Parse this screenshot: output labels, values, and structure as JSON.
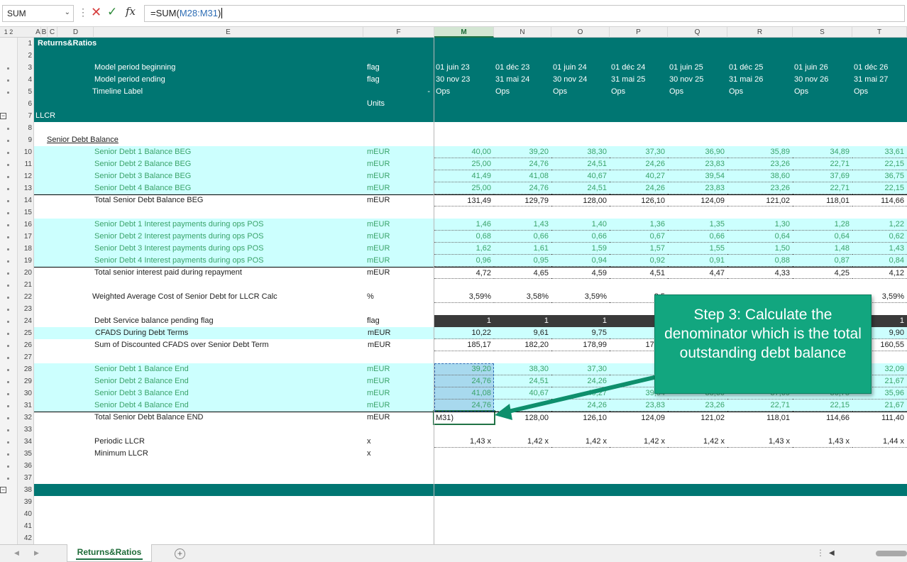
{
  "formula_bar": {
    "name_box": "SUM",
    "formula_prefix": "=SUM(",
    "formula_ref": "M28:M31",
    "formula_suffix": ")",
    "cancel_icon": "close-icon",
    "enter_icon": "check-icon",
    "fx_label": "fx"
  },
  "outline_levels": "1 2",
  "columns_left": [
    "A",
    "B",
    "C",
    "D",
    "E",
    "F"
  ],
  "columns_right": [
    "M",
    "N",
    "O",
    "P",
    "Q",
    "R",
    "S",
    "T"
  ],
  "selected_column": "M",
  "row_numbers": [
    "1",
    "2",
    "3",
    "4",
    "5",
    "6",
    "7",
    "8",
    "9",
    "10",
    "11",
    "12",
    "13",
    "14",
    "15",
    "16",
    "17",
    "18",
    "19",
    "20",
    "21",
    "22",
    "23",
    "24",
    "25",
    "26",
    "27",
    "28",
    "29",
    "30",
    "31",
    "32",
    "33",
    "34",
    "35",
    "36",
    "37",
    "38",
    "39",
    "40",
    "41",
    "42"
  ],
  "header_rows": {
    "r1_title": "Returns&Ratios",
    "r3_label": "Model period beginning",
    "r3_unit": "flag",
    "r4_label": "Model period ending",
    "r4_unit": "flag",
    "r5_label": "Timeline Label",
    "r5_unit": "-",
    "r6_unit": "Units",
    "r7_label": "LLCR",
    "beginning": [
      "01 juin 23",
      "01 déc 23",
      "01 juin 24",
      "01 déc 24",
      "01 juin 25",
      "01 déc 25",
      "01 juin 26",
      "01 déc 26"
    ],
    "ending": [
      "30 nov 23",
      "31 mai 24",
      "30 nov 24",
      "31 mai 25",
      "30 nov 25",
      "31 mai 26",
      "30 nov 26",
      "31 mai 27"
    ],
    "timeline": [
      "Ops",
      "Ops",
      "Ops",
      "Ops",
      "Ops",
      "Ops",
      "Ops",
      "Ops"
    ]
  },
  "section_title": "Senior Debt Balance",
  "rows": {
    "r10": {
      "label": "Senior Debt 1 Balance BEG",
      "unit": "mEUR",
      "values": [
        "40,00",
        "39,20",
        "38,30",
        "37,30",
        "36,90",
        "35,89",
        "34,89",
        "33,61"
      ]
    },
    "r11": {
      "label": "Senior Debt 2 Balance BEG",
      "unit": "mEUR",
      "values": [
        "25,00",
        "24,76",
        "24,51",
        "24,26",
        "23,83",
        "23,26",
        "22,71",
        "22,15"
      ]
    },
    "r12": {
      "label": "Senior Debt 3 Balance BEG",
      "unit": "mEUR",
      "values": [
        "41,49",
        "41,08",
        "40,67",
        "40,27",
        "39,54",
        "38,60",
        "37,69",
        "36,75"
      ]
    },
    "r13": {
      "label": "Senior Debt 4 Balance BEG",
      "unit": "mEUR",
      "values": [
        "25,00",
        "24,76",
        "24,51",
        "24,26",
        "23,83",
        "23,26",
        "22,71",
        "22,15"
      ]
    },
    "r14": {
      "label": "Total Senior Debt Balance BEG",
      "unit": "mEUR",
      "values": [
        "131,49",
        "129,79",
        "128,00",
        "126,10",
        "124,09",
        "121,02",
        "118,01",
        "114,66"
      ]
    },
    "r16": {
      "label": "Senior Debt 1 Interest payments during ops POS",
      "unit": "mEUR",
      "values": [
        "1,46",
        "1,43",
        "1,40",
        "1,36",
        "1,35",
        "1,30",
        "1,28",
        "1,22"
      ]
    },
    "r17": {
      "label": "Senior Debt 2 Interest payments during ops POS",
      "unit": "mEUR",
      "values": [
        "0,68",
        "0,66",
        "0,66",
        "0,67",
        "0,66",
        "0,64",
        "0,64",
        "0,62"
      ]
    },
    "r18": {
      "label": "Senior Debt 3 Interest payments during ops POS",
      "unit": "mEUR",
      "values": [
        "1,62",
        "1,61",
        "1,59",
        "1,57",
        "1,55",
        "1,50",
        "1,48",
        "1,43"
      ]
    },
    "r19": {
      "label": "Senior Debt 4 Interest payments during ops POS",
      "unit": "mEUR",
      "values": [
        "0,96",
        "0,95",
        "0,94",
        "0,92",
        "0,91",
        "0,88",
        "0,87",
        "0,84"
      ]
    },
    "r20": {
      "label": "Total senior interest paid during repayment",
      "unit": "mEUR",
      "values": [
        "4,72",
        "4,65",
        "4,59",
        "4,51",
        "4,47",
        "4,33",
        "4,25",
        "4,12"
      ]
    },
    "r22": {
      "label": "Weighted Average Cost of Senior Debt for LLCR Calc",
      "unit": "%",
      "values": [
        "3,59%",
        "3,58%",
        "3,59%",
        "3,5",
        "",
        "",
        "",
        "3,59%"
      ]
    },
    "r24": {
      "label": "Debt Service balance pending flag",
      "unit": "flag",
      "values": [
        "1",
        "1",
        "1",
        "",
        "",
        "",
        "",
        "1"
      ]
    },
    "r25": {
      "label": "CFADS During Debt Terms",
      "unit": "mEUR",
      "values": [
        "10,22",
        "9,61",
        "9,75",
        "9,6",
        "",
        "",
        "",
        "9,90"
      ]
    },
    "r26": {
      "label": "Sum of Discounted CFADS over Senior Debt Term",
      "unit": "mEUR",
      "values": [
        "185,17",
        "182,20",
        "178,99",
        "175,1",
        "",
        "",
        "",
        "160,55"
      ]
    },
    "r28": {
      "label": "Senior Debt 1 Balance End",
      "unit": "mEUR",
      "values": [
        "39,20",
        "38,30",
        "37,30",
        "36,",
        "",
        "",
        "",
        "32,09"
      ]
    },
    "r29": {
      "label": "Senior Debt 2 Balance End",
      "unit": "mEUR",
      "values": [
        "24,76",
        "24,51",
        "24,26",
        "23,",
        "",
        "",
        "",
        "21,67"
      ]
    },
    "r30": {
      "label": "Senior Debt 3 Balance End",
      "unit": "mEUR",
      "values": [
        "41,08",
        "40,67",
        "40,27",
        "39,54",
        "38,60",
        "37,69",
        "36,75",
        "35,96"
      ]
    },
    "r31": {
      "label": "Senior Debt 4 Balance End",
      "unit": "mEUR",
      "values": [
        "24,76",
        "",
        "24,26",
        "23,83",
        "23,26",
        "22,71",
        "22,15",
        "21,67"
      ]
    },
    "r32": {
      "label": "Total Senior Debt Balance END",
      "unit": "mEUR",
      "values": [
        "M31)",
        "128,00",
        "126,10",
        "124,09",
        "121,02",
        "118,01",
        "114,66",
        "111,40"
      ]
    },
    "r34": {
      "label": "Periodic   LLCR",
      "unit": "x",
      "values": [
        "1,43 x",
        "1,42 x",
        "1,42 x",
        "1,42 x",
        "1,42 x",
        "1,43 x",
        "1,43 x",
        "1,44 x"
      ]
    },
    "r35": {
      "label": "Minimum LLCR",
      "unit": "x",
      "values": []
    }
  },
  "callout": {
    "text": "Step 3: Calculate the denominator which is the total outstanding debt balance"
  },
  "tabs": {
    "active": "Returns&Ratios",
    "add_icon": "plus-icon"
  },
  "colors": {
    "teal": "#007672",
    "cyan_fill": "#ccfffe",
    "input_green": "#3aa36a",
    "callout": "#12a67f"
  }
}
